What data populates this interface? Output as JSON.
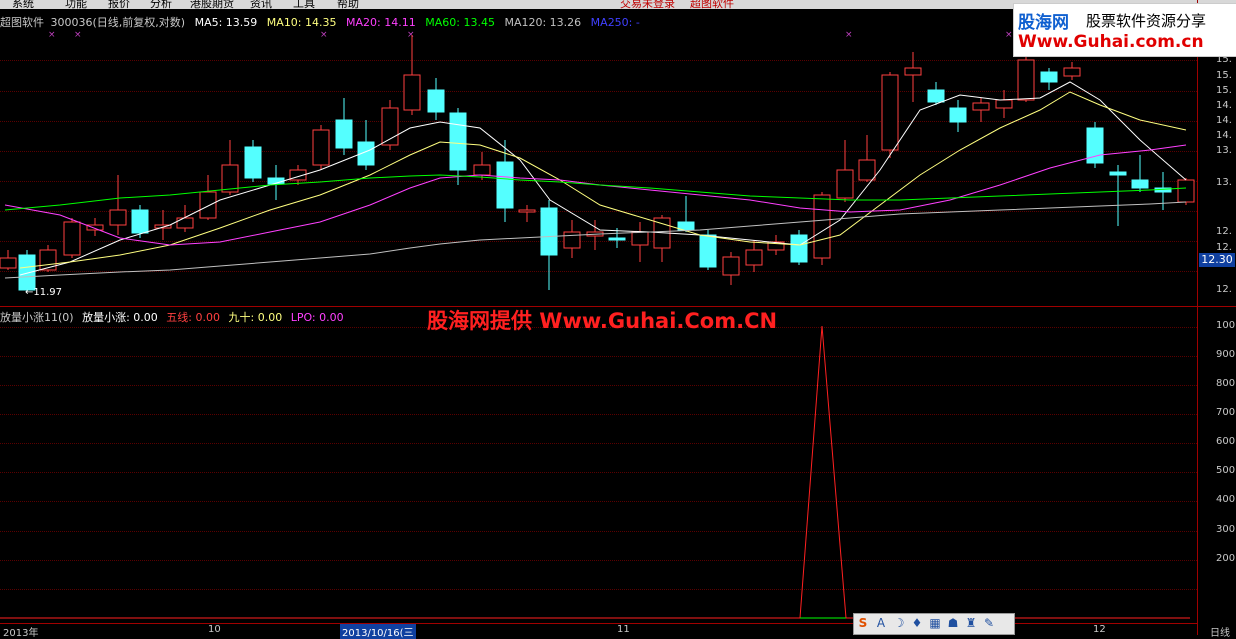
{
  "menu": [
    "系统",
    "功能",
    "报价",
    "分析",
    "港股期货",
    "资讯",
    "工具",
    "帮助"
  ],
  "menu_status": [
    "交易未登录",
    "超图软件"
  ],
  "app_name": "超图软件",
  "title_line": {
    "code": "300036(日线,前复权,对数)",
    "ma5": "MA5: 13.59",
    "ma10": "MA10: 14.35",
    "ma20": "MA20: 14.11",
    "ma60": "MA60: 13.45",
    "ma120": "MA120: 13.26",
    "ma250": "MA250: -"
  },
  "colors": {
    "ma5": "#ffffff",
    "ma10": "#ffff80",
    "ma20": "#ff40ff",
    "ma60": "#00ff00",
    "ma120": "#c0c0c0",
    "ma250": "#4040ff",
    "up": "#ff4040",
    "down": "#54ffff",
    "indicator": "#ff2020"
  },
  "price_axis": [
    "15.",
    "15.",
    "15.",
    "14.",
    "14.",
    "14.",
    "13.",
    "13.",
    "12.",
    "12.",
    "12."
  ],
  "current_price": "12.30",
  "low_label": "←11.97",
  "indicator": {
    "name": "放量小涨11(0)",
    "l1": "放量小涨: 0.00",
    "l2": "五线: 0.00",
    "l3": "九十: 0.00",
    "l4": "LPO: 0.00"
  },
  "indicator_axis": [
    "100",
    "900",
    "800",
    "700",
    "600",
    "500",
    "400",
    "300",
    "200"
  ],
  "watermark": "股海网提供 Www.Guhai.Com.CN",
  "logo": {
    "name": "股海网",
    "slogan": "股票软件资源分享",
    "url": "Www.Guhai.com.cn"
  },
  "dates": [
    "2013年",
    "10",
    "2013/10/16(三",
    "11",
    "12"
  ],
  "period": "日线",
  "toolbar_icons": [
    "S",
    "A",
    "☽",
    "♦",
    "▦",
    "☗",
    "♜",
    "✎"
  ]
}
